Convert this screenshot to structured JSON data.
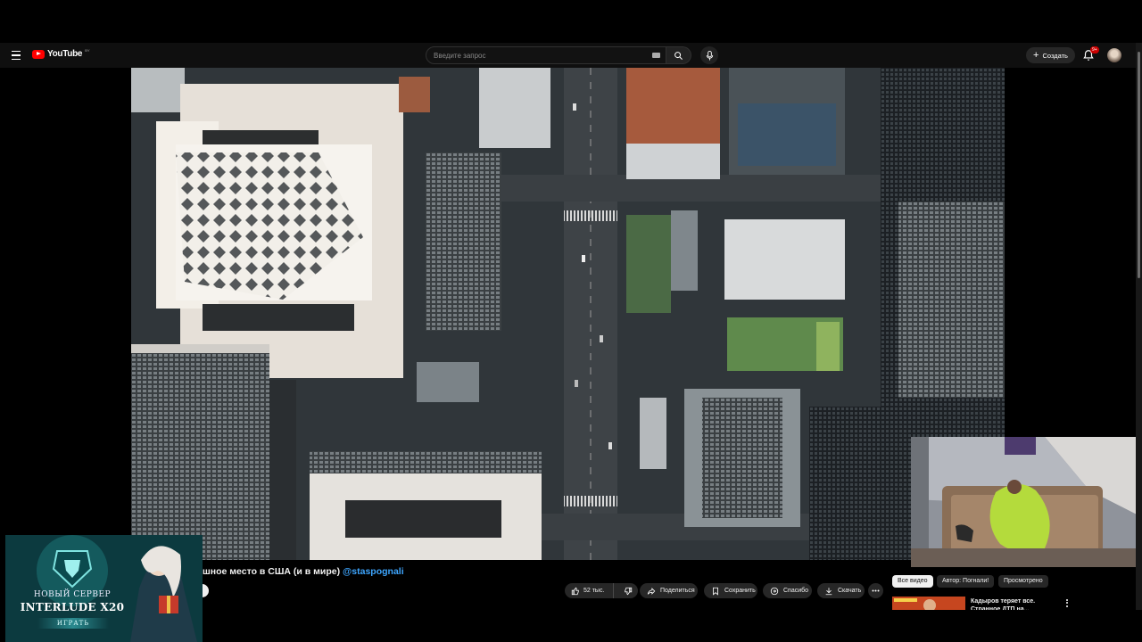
{
  "masthead": {
    "logo_text": "YouTube",
    "logo_region": "BY",
    "search_placeholder": "Введите запрос",
    "create_label": "Создать",
    "notifications_badge": "9+"
  },
  "video": {
    "title_text": "шное место в США (и в мире) ",
    "channel_handle": "@staspognali"
  },
  "actions": {
    "like_count": "52 тыс.",
    "share_label": "Поделиться",
    "save_label": "Сохранить",
    "thanks_label": "Спасибо",
    "download_label": "Скачать"
  },
  "chips": {
    "all": "Все видео",
    "author": "Автор: Погнали!",
    "watched": "Просмотрено"
  },
  "recommendation": {
    "title": "Кадыров теряет все. Странное ДТП на..."
  },
  "ad": {
    "line1": "НОВЫЙ СЕРВЕР",
    "line2": "INTERLUDE X20",
    "cta": "ИГРАТЬ"
  },
  "colors": {
    "brand_red": "#ff0000",
    "link_blue": "#3ea6ff",
    "background": "#0f0f0f"
  }
}
